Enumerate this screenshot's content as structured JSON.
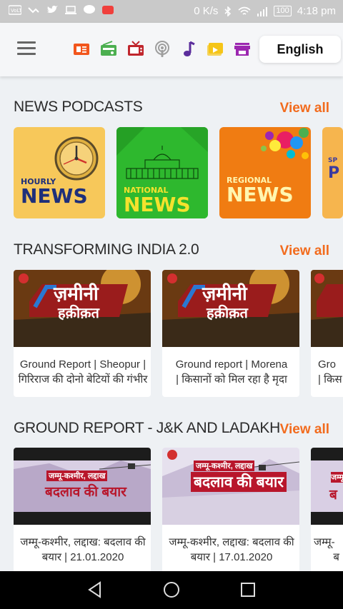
{
  "status_bar": {
    "speed": "0 K/s",
    "battery": "100",
    "time": "4:18 pm"
  },
  "header": {
    "language_button": "English",
    "category_icons": [
      "newspaper-icon",
      "radio-icon",
      "tv-icon",
      "podcast-icon",
      "music-icon",
      "video-icon",
      "store-icon"
    ]
  },
  "sections": [
    {
      "title": "NEWS PODCASTS",
      "view_all": "View all",
      "items": [
        {
          "line1": "HOURLY",
          "line2": "NEWS"
        },
        {
          "line1": "NATIONAL",
          "line2": "NEWS"
        },
        {
          "line1": "REGIONAL",
          "line2": "NEWS"
        },
        {
          "line1": "SP",
          "line2": "P"
        }
      ]
    },
    {
      "title": "TRANSFORMING INDIA 2.0",
      "view_all": "View all",
      "items": [
        {
          "banner_line1": "ज़मीनी",
          "banner_line2": "हक़ीक़त",
          "caption_1": "Ground Report | Sheopur |",
          "caption_2": "गिरिराज की दोनो बेटियों की गंभीर"
        },
        {
          "banner_line1": "ज़मीनी",
          "banner_line2": "हक़ीक़त",
          "caption_1": "Ground report | Morena",
          "caption_2": "| किसानों को मिल रहा है मृदा"
        },
        {
          "caption_1": "Gro",
          "caption_2": "| किस"
        }
      ]
    },
    {
      "title": "GROUND REPORT - J&K AND LADAKH",
      "view_all": "View all",
      "items": [
        {
          "banner_line1": "जम्मू-कश्मीर, लद्दाख",
          "banner_line2": "बदलाव की बयार",
          "caption_1": "जम्मू-कश्मीर, लद्दाख: बदलाव की",
          "caption_2": "बयार | 21.01.2020"
        },
        {
          "banner_line1": "जम्मू-कश्मीर, लद्दाख",
          "banner_line2": "बदलाव की बयार",
          "caption_1": "जम्मू-कश्मीर, लद्दाख: बदलाव की",
          "caption_2": "बयार | 17.01.2020"
        },
        {
          "banner_line1": "जम्मू",
          "banner_line2": "ब",
          "caption_1": "जम्मू-",
          "caption_2": "ब"
        }
      ]
    }
  ],
  "colors": {
    "accent": "#f26b1d",
    "hourly_bg": "#f7c85a",
    "national_bg": "#2eb82e",
    "regional_bg": "#f07c12"
  }
}
